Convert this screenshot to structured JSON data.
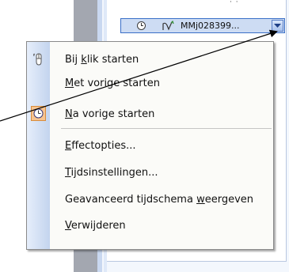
{
  "anim_item": {
    "label": "MMj028399...",
    "timing_icon": "clock-icon",
    "effect_icon": "motion-path-icon",
    "dropdown_icon": "dropdown-arrow-icon"
  },
  "menu": {
    "items": [
      {
        "pre": "Bij ",
        "key": "k",
        "post": "lik starten",
        "icon": "mouse-icon"
      },
      {
        "pre": "",
        "key": "M",
        "post": "et vorige starten"
      },
      {
        "pre": "",
        "key": "N",
        "post": "a vorige starten",
        "icon": "clock-icon",
        "checked": true
      },
      {
        "pre": "",
        "key": "E",
        "post": "ffectopties..."
      },
      {
        "pre": "",
        "key": "T",
        "post": "ijdsinstellingen..."
      },
      {
        "pre": "Geavanceerd tijdschema ",
        "key": "w",
        "post": "eergeven"
      },
      {
        "pre": "",
        "key": "V",
        "post": "erwijderen"
      }
    ]
  },
  "colors": {
    "menu_background": "#fbfbf8",
    "gutter_light": "#e6eefb",
    "gutter_dark": "#c3d4ee",
    "checked_highlight": "#f7c490",
    "item_selection": "#cddcf3"
  }
}
